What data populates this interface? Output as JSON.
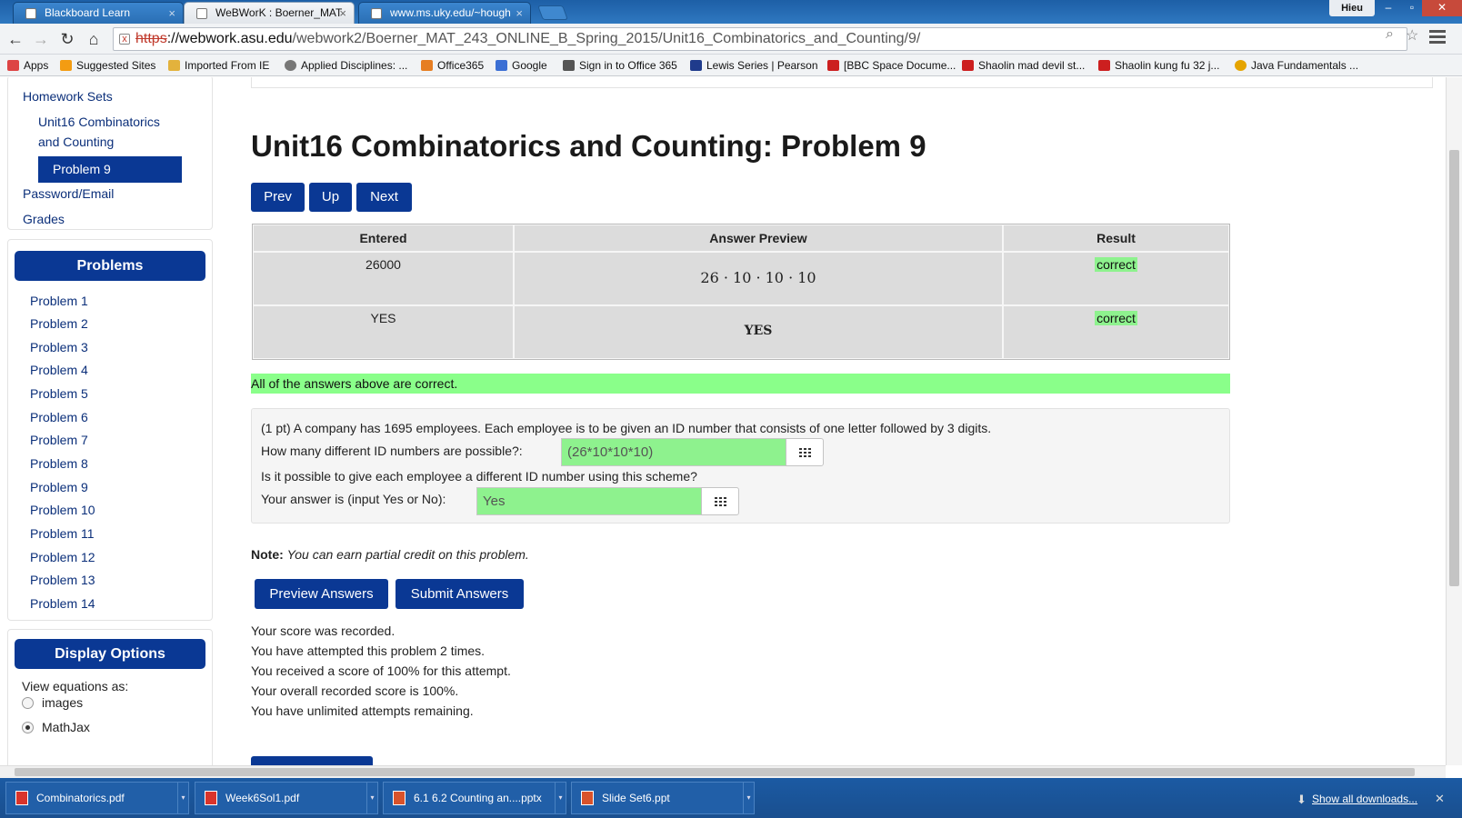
{
  "browser": {
    "tabs": [
      {
        "label": "Blackboard Learn",
        "active": false
      },
      {
        "label": "WeBWorK : Boerner_MAT",
        "active": true
      },
      {
        "label": "www.ms.uky.edu/~hough",
        "active": false
      }
    ],
    "user": "Hieu",
    "window_controls": {
      "minimize": "–",
      "restore": "▫",
      "close": "✕"
    },
    "url": {
      "scheme": "https",
      "host": "://webwork.asu.edu",
      "path": "/webwork2/Boerner_MAT_243_ONLINE_B_Spring_2015/Unit16_Combinatorics_and_Counting/9/"
    },
    "bookmarks": [
      {
        "label": "Apps",
        "color": "#d44"
      },
      {
        "label": "Suggested Sites",
        "color": "#f39c12"
      },
      {
        "label": "Imported From IE",
        "color": "#e3b23c"
      },
      {
        "label": "Applied Disciplines: ...",
        "color": "#777"
      },
      {
        "label": "Office365",
        "color": "#e67e22"
      },
      {
        "label": "Google",
        "color": "#3b6fd4"
      },
      {
        "label": "Sign in to Office 365",
        "color": "#555"
      },
      {
        "label": "Lewis Series | Pearson",
        "color": "#1f3b8c"
      },
      {
        "label": "[BBC Space Docume...",
        "color": "#cc1f1f"
      },
      {
        "label": "Shaolin mad devil st...",
        "color": "#cc1f1f"
      },
      {
        "label": "Shaolin kung fu 32 j...",
        "color": "#cc1f1f"
      },
      {
        "label": "Java Fundamentals ...",
        "color": "#e5a400"
      }
    ]
  },
  "sidebar": {
    "nav": {
      "homework_sets": "Homework Sets",
      "set_line1": "Unit16 Combinatorics",
      "set_line2": "and Counting",
      "active_problem": "Problem 9",
      "password": "Password/Email",
      "grades": "Grades"
    },
    "problems_header": "Problems",
    "problems": [
      "Problem 1",
      "Problem 2",
      "Problem 3",
      "Problem 4",
      "Problem 5",
      "Problem 6",
      "Problem 7",
      "Problem 8",
      "Problem 9",
      "Problem 10",
      "Problem 11",
      "Problem 12",
      "Problem 13",
      "Problem 14"
    ],
    "display_header": "Display Options",
    "view_label": "View equations as:",
    "options": [
      {
        "label": "images",
        "selected": false
      },
      {
        "label": "MathJax",
        "selected": true
      }
    ]
  },
  "main": {
    "title": "Unit16 Combinatorics and Counting: Problem 9",
    "nav_buttons": {
      "prev": "Prev",
      "up": "Up",
      "next": "Next"
    },
    "results_table": {
      "headers": [
        "Entered",
        "Answer Preview",
        "Result"
      ],
      "rows": [
        {
          "entered": "26000",
          "preview": "26 · 10 · 10 · 10",
          "result": "correct"
        },
        {
          "entered": "YES",
          "preview": "YES",
          "result": "correct"
        }
      ]
    },
    "all_correct": "All of the answers above are correct.",
    "problem": {
      "statement": "(1 pt) A company has 1695 employees. Each employee is to be given an ID number that consists of one letter followed by 3 digits.",
      "q1_label": "How many different ID numbers are possible?:",
      "q1_value": "(26*10*10*10)",
      "q2_text": "Is it possible to give each employee a different ID number using this scheme?",
      "q2_label": "Your answer is (input Yes or No):",
      "q2_value": "Yes"
    },
    "note_label": "Note:",
    "note_text": "You can earn partial credit on this problem.",
    "buttons": {
      "preview": "Preview Answers",
      "submit": "Submit Answers"
    },
    "messages": [
      "Your score was recorded.",
      "You have attempted this problem 2 times.",
      "You received a score of 100% for this attempt.",
      "Your overall recorded score is 100%.",
      "You have unlimited attempts remaining."
    ]
  },
  "downloads": {
    "items": [
      "Combinatorics.pdf",
      "Week6Sol1.pdf",
      "6.1 6.2 Counting an....pptx",
      "Slide Set6.ppt"
    ],
    "show_all": "Show all downloads..."
  },
  "colors": {
    "accent": "#0a3894",
    "correct": "#8ef28e",
    "chrome": "#2f78c0"
  }
}
